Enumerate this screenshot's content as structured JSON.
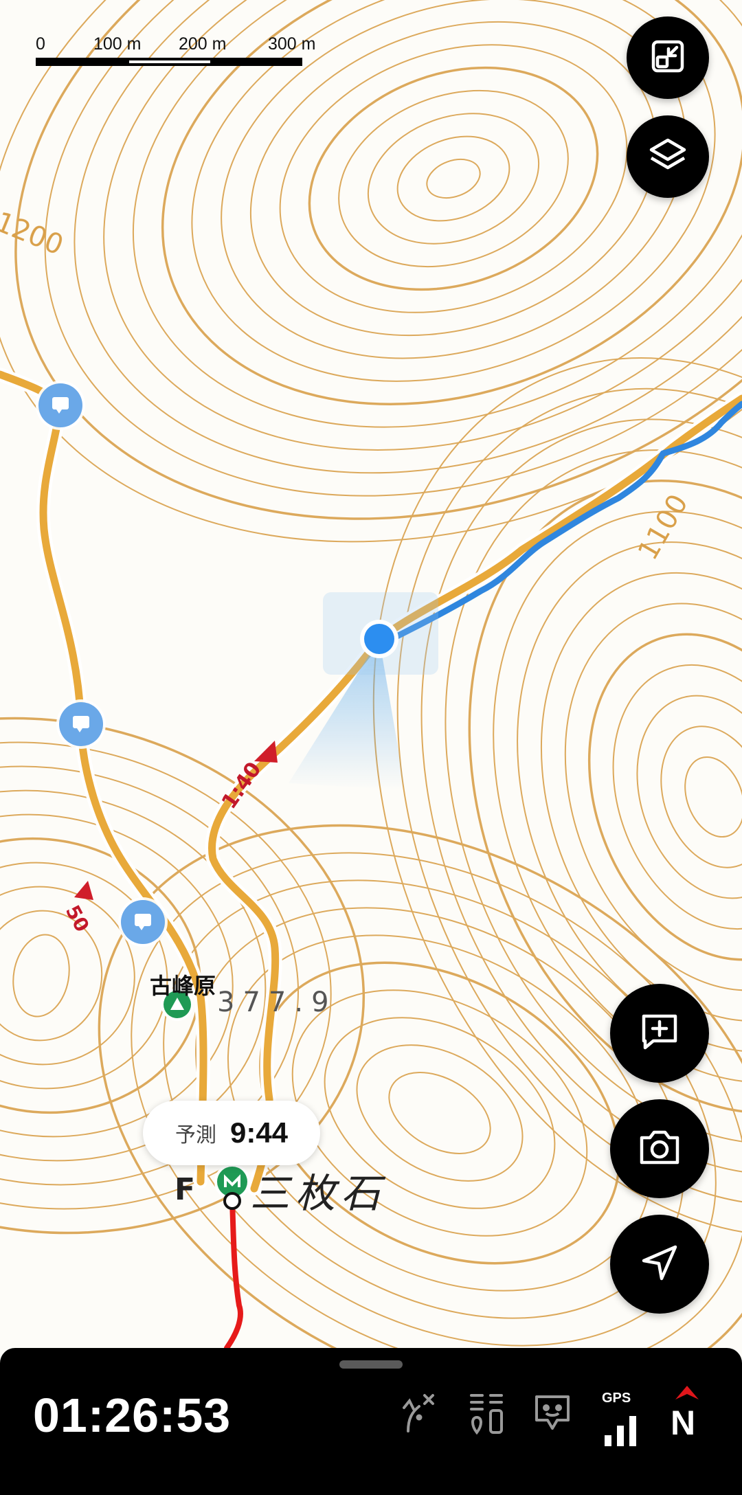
{
  "scale": {
    "labels": [
      "0",
      "100 m",
      "200 m",
      "300 m"
    ]
  },
  "contour_labels": [
    "1200",
    "1100"
  ],
  "route_markers": {
    "segment_time_1": "1:40",
    "segment_time_2": "50"
  },
  "places": {
    "peak_name": "古峰原",
    "elevation": "377.9",
    "site_name": "三枚石",
    "partial_label": "F"
  },
  "prediction": {
    "label": "予測",
    "time": "9:44"
  },
  "buttons": {
    "fullscreen_icon": "fullscreen-exit-icon",
    "layers_icon": "layers-icon",
    "add_note_icon": "add-comment-icon",
    "camera_icon": "camera-icon",
    "navigate_icon": "navigation-arrow-icon"
  },
  "bottom_bar": {
    "elapsed_time": "01:26:53",
    "gps_label": "GPS",
    "compass_label": "N"
  },
  "colors": {
    "trail": "#E8A93A",
    "track": "#2F86DE",
    "planned_route": "#E61A1A",
    "contour": "#D9A04A",
    "location": "#2C8EF0",
    "compass": "#E0161B"
  }
}
